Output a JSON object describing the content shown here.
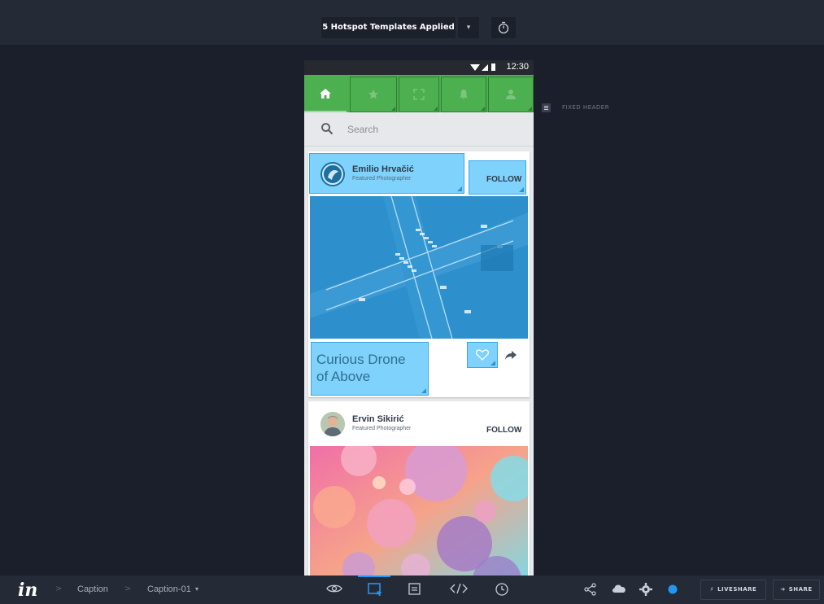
{
  "topbar": {
    "templates_label": "5 Hotspot Templates Applied",
    "templates_caret": "▾"
  },
  "phone": {
    "status_time": "12:30",
    "nav_icons": [
      "home-icon",
      "star-icon",
      "fullscreen-icon",
      "bell-icon",
      "person-icon"
    ],
    "search_placeholder": "Search",
    "posts": [
      {
        "name": "Emilio Hrvačić",
        "role": "Featured Photographer",
        "follow_label": "FOLLOW",
        "caption": "Curious Drone of Above"
      },
      {
        "name": "Ervin Sikirić",
        "role": "Featured Photographer",
        "follow_label": "FOLLOW"
      }
    ]
  },
  "side_panel": {
    "fixed_header_label": "FIXED HEADER"
  },
  "bottombar": {
    "crumbs": [
      "Caption",
      "Caption-01"
    ],
    "crumb_caret": "▾",
    "tools": [
      "eye-icon",
      "hotspot-icon",
      "comment-icon",
      "code-icon",
      "history-icon"
    ],
    "active_tool": "hotspot-icon",
    "right_icons": [
      "share-nodes-icon",
      "cloud-sync-icon",
      "settings-icon",
      "status-dot-icon"
    ],
    "liveshare_label": "LIVESHARE",
    "share_label": "SHARE"
  },
  "colors": {
    "app_bar": "#4caf50",
    "hotspot_blue": "#7fd2fb",
    "accent": "#2196f3"
  }
}
